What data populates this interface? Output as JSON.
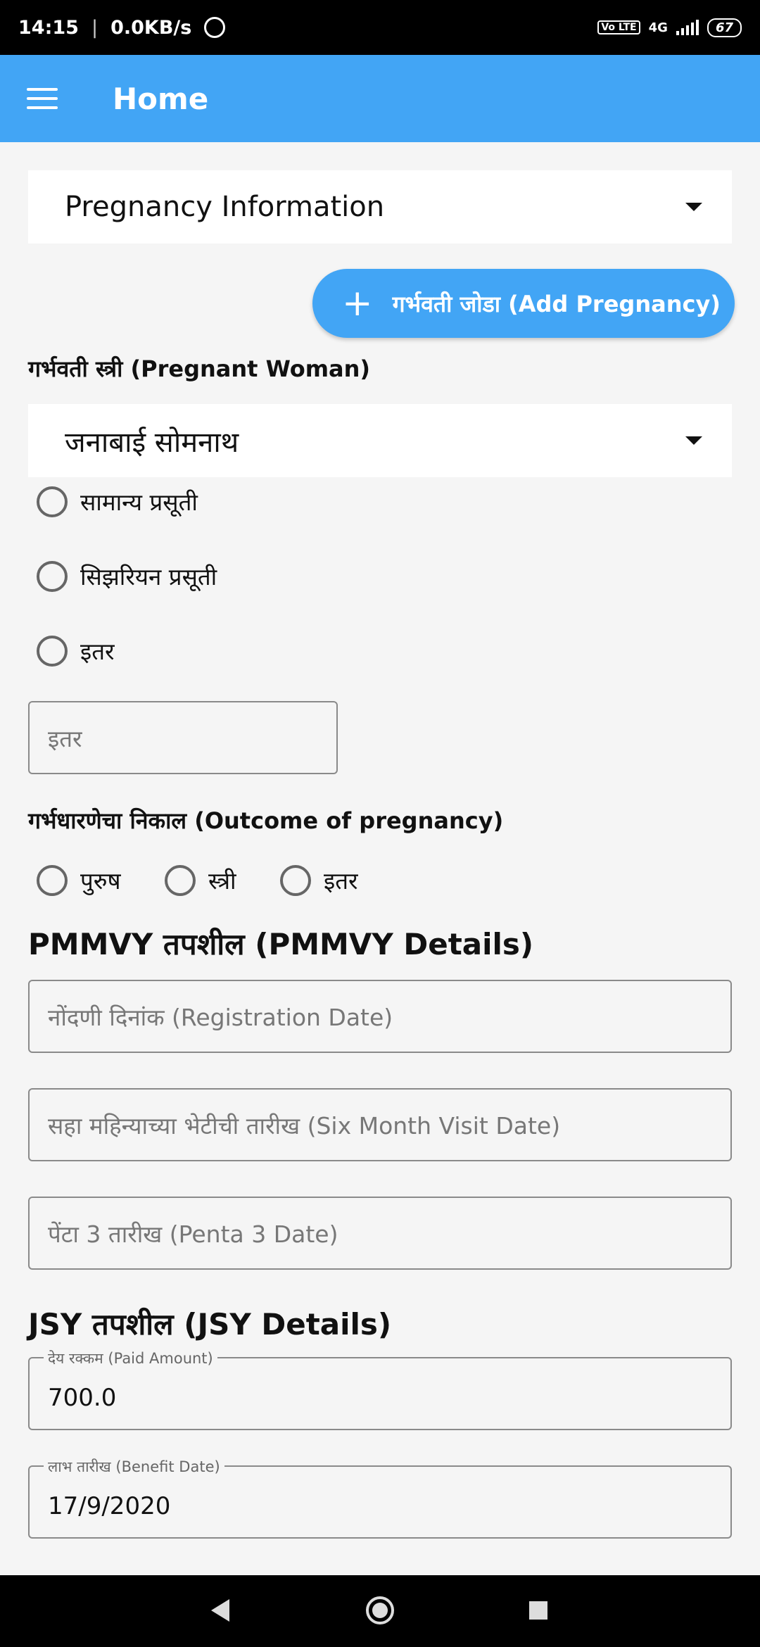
{
  "status_bar": {
    "time": "14:15",
    "network_speed": "0.0KB/s",
    "network_type": "4G",
    "volte": "Vo LTE",
    "battery": "67"
  },
  "app_bar": {
    "title": "Home"
  },
  "pregnancy_dropdown": {
    "value": "Pregnancy Information"
  },
  "add_pregnancy_button": {
    "label": "गर्भवती जोडा (Add Pregnancy)"
  },
  "pregnant_woman": {
    "label": "गर्भवती स्त्री (Pregnant Woman)",
    "selected": "जनाबाई सोमनाथ"
  },
  "delivery_type": {
    "options": [
      "सामान्य प्रसूती",
      "सिझरियन प्रसूती",
      "इतर"
    ],
    "other_placeholder": "इतर"
  },
  "outcome": {
    "label": "गर्भधारणेचा निकाल (Outcome of pregnancy)",
    "options": [
      "पुरुष",
      "स्त्री",
      "इतर"
    ]
  },
  "pmmvy": {
    "heading": "PMMVY तपशील (PMMVY Details)",
    "registration_date_placeholder": "नोंदणी दिनांक (Registration Date)",
    "six_month_visit_placeholder": "सहा महिन्याच्या भेटीची तारीख (Six Month Visit Date)",
    "penta3_placeholder": "पेंटा 3 तारीख (Penta 3 Date)"
  },
  "jsy": {
    "heading": "JSY तपशील (JSY Details)",
    "paid_amount_label": "देय रक्कम (Paid Amount)",
    "paid_amount_value": "700.0",
    "benefit_date_label": "लाभ तारीख (Benefit Date)",
    "benefit_date_value": "17/9/2020"
  },
  "colors": {
    "primary": "#42a5f5",
    "background": "#f5f5f5"
  }
}
